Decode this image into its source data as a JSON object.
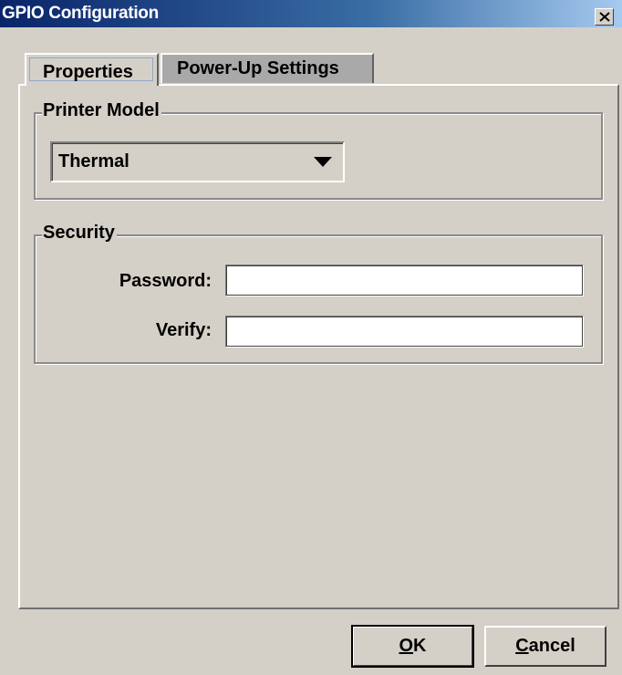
{
  "window": {
    "title": "GPIO Configuration",
    "close_symbol": "×"
  },
  "tabs": [
    {
      "label": "Properties",
      "selected": true
    },
    {
      "label": "Power-Up Settings",
      "selected": false
    }
  ],
  "printer_model": {
    "group_label": "Printer Model",
    "selected_value": "Thermal",
    "arrow_icon": "dropdown-arrow-icon"
  },
  "security": {
    "group_label": "Security",
    "password_label": "Password:",
    "password_value": "",
    "verify_label": "Verify:",
    "verify_value": ""
  },
  "buttons": {
    "ok_mnemonic": "O",
    "ok_rest": "K",
    "cancel_mnemonic": "C",
    "cancel_rest": "ancel"
  },
  "colors": {
    "title_bar_start": "#0a246a",
    "title_bar_end": "#a6caf0",
    "dialog_bg": "#d4d0c8",
    "inactive_tab_bg": "#a9a9a9"
  }
}
